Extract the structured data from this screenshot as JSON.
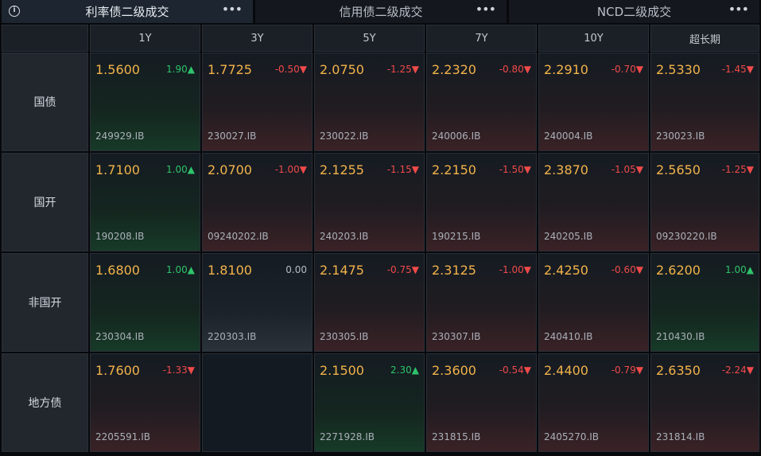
{
  "tabs": [
    {
      "label": "利率债二级成交",
      "active": true
    },
    {
      "label": "信用债二级成交",
      "active": false
    },
    {
      "label": "NCD二级成交",
      "active": false
    }
  ],
  "info_glyph": "i",
  "more_glyph": "•••",
  "columns": [
    "1Y",
    "3Y",
    "5Y",
    "7Y",
    "10Y",
    "超长期"
  ],
  "rows": [
    {
      "label": "国债",
      "cells": [
        {
          "price": "1.5600",
          "change": "1.90▲",
          "dir": "up",
          "code": "249929.IB"
        },
        {
          "price": "1.7725",
          "change": "-0.50▼",
          "dir": "down",
          "code": "230027.IB"
        },
        {
          "price": "2.0750",
          "change": "-1.25▼",
          "dir": "down",
          "code": "230022.IB"
        },
        {
          "price": "2.2320",
          "change": "-0.80▼",
          "dir": "down",
          "code": "240006.IB"
        },
        {
          "price": "2.2910",
          "change": "-0.70▼",
          "dir": "down",
          "code": "240004.IB"
        },
        {
          "price": "2.5330",
          "change": "-1.45▼",
          "dir": "down",
          "code": "230023.IB"
        }
      ]
    },
    {
      "label": "国开",
      "cells": [
        {
          "price": "1.7100",
          "change": "1.00▲",
          "dir": "up",
          "code": "190208.IB"
        },
        {
          "price": "2.0700",
          "change": "-1.00▼",
          "dir": "down",
          "code": "09240202.IB"
        },
        {
          "price": "2.1255",
          "change": "-1.15▼",
          "dir": "down",
          "code": "240203.IB"
        },
        {
          "price": "2.2150",
          "change": "-1.50▼",
          "dir": "down",
          "code": "190215.IB"
        },
        {
          "price": "2.3870",
          "change": "-1.05▼",
          "dir": "down",
          "code": "240205.IB"
        },
        {
          "price": "2.5650",
          "change": "-1.25▼",
          "dir": "down",
          "code": "09230220.IB"
        }
      ]
    },
    {
      "label": "非国开",
      "cells": [
        {
          "price": "1.6800",
          "change": "1.00▲",
          "dir": "up",
          "code": "230304.IB"
        },
        {
          "price": "1.8100",
          "change": "0.00",
          "dir": "flat",
          "code": "220303.IB"
        },
        {
          "price": "2.1475",
          "change": "-0.75▼",
          "dir": "down",
          "code": "230305.IB"
        },
        {
          "price": "2.3125",
          "change": "-1.00▼",
          "dir": "down",
          "code": "230307.IB"
        },
        {
          "price": "2.4250",
          "change": "-0.60▼",
          "dir": "down",
          "code": "240410.IB"
        },
        {
          "price": "2.6200",
          "change": "1.00▲",
          "dir": "up",
          "code": "210430.IB"
        }
      ]
    },
    {
      "label": "地方债",
      "cells": [
        {
          "price": "1.7600",
          "change": "-1.33▼",
          "dir": "down",
          "code": "2205591.IB"
        },
        {
          "price": "",
          "change": "",
          "dir": "empty",
          "code": ""
        },
        {
          "price": "2.1500",
          "change": "2.30▲",
          "dir": "up",
          "code": "2271928.IB"
        },
        {
          "price": "2.3600",
          "change": "-0.54▼",
          "dir": "down",
          "code": "231815.IB"
        },
        {
          "price": "2.4400",
          "change": "-0.79▼",
          "dir": "down",
          "code": "2405270.IB"
        },
        {
          "price": "2.6350",
          "change": "-2.24▼",
          "dir": "down",
          "code": "231814.IB"
        }
      ]
    }
  ],
  "colors": {
    "price": "#f2b34a",
    "up": "#2ec46b",
    "down": "#f04a4a",
    "background": "#07090c"
  }
}
